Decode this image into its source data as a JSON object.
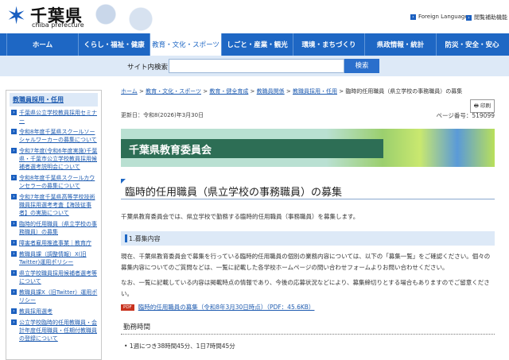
{
  "header": {
    "logo_text": "千葉県",
    "logo_sub": "chiba prefecture",
    "links": [
      "Foreign Languages",
      "閲覧補助機能"
    ]
  },
  "nav": [
    "ホーム",
    "くらし・福祉・健康",
    "教育・文化・スポーツ",
    "しごと・産業・観光",
    "環境・まちづくり",
    "県政情報・統計",
    "防災・安全・安心"
  ],
  "search": {
    "label": "サイト内検索",
    "value": "",
    "button": "検索"
  },
  "sidebar": {
    "heading": "教職員採用・任用",
    "items": [
      "千葉県公立学校教員採用セミナー",
      "令和8年度千葉県スクールソーシャルワーカーの募集について",
      "令和7年度(令和6年度実施)千葉県・千葉市公立学校教員採用候補者選考説明会について",
      "令和8年度千葉県スクールカウンセラーの募集について",
      "令和7年度千葉県高等学校技術職員採用選考考査【海技従事者】の実施について",
      "臨時的任用職員（県立学校の事務職員）の募集",
      "障害者雇用推進事業｜教育庁",
      "教職員課（調整情報）X(旧Twitter)運用ポリシー",
      "県立学校職員採用候補者選考等について",
      "教職員課X（旧Twitter）運用ポリシー",
      "教員採用選考",
      "公立学校臨時的任用教職員・会計年度任用職員・任期付教職員の登録について"
    ]
  },
  "breadcrumb": {
    "links": [
      "ホーム",
      "教育・文化・スポーツ",
      "教育・健全育成",
      "教職員関係",
      "教職員採用・任用"
    ],
    "current": "臨時的任用職員（県立学校の事務職員）の募集"
  },
  "print_label": "印刷",
  "updated": "更新日：令和8(2026)年3月30日",
  "page_number": "ページ番号：519099",
  "banner": "千葉県教育委員会",
  "title": "臨時的任用職員（県立学校の事務職員）の募集",
  "intro": "千葉県教育委員会では、県立学校で勤務する臨時的任用職員（事務職員）を募集します。",
  "section1": "1.募集内容",
  "paras": [
    "現在、千葉県教育委員会で募集を行っている臨時的任用職員の個別の業務内容については、以下の「募集一覧」をご確認ください。個々の募集内容についてのご質問などは、一覧に記載した各学校ホームページの問い合わせフォームよりお問い合わせください。",
    "なお、一覧に記載している内容は掲載時点の情報であり、今後の応募状況などにより、募集締切りとする場合もありますのでご留意ください。"
  ],
  "pdf": {
    "icon": "PDF",
    "link": "臨時的任用職員の募集（令和8年3月30日時点）（PDF：45.6KB）"
  },
  "work": {
    "heading": "勤務時間",
    "items": [
      "1週につき38時間45分、1日7時間45分"
    ]
  }
}
